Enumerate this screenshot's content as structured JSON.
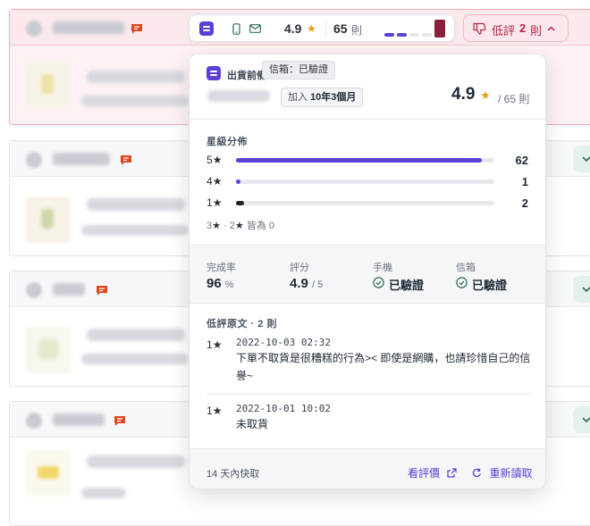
{
  "topbar": {
    "score": "4.9",
    "review_count": "65",
    "count_unit": "則",
    "colors": {
      "brand": "#5b3fd6",
      "star": "#e6a019",
      "low_bar": "#8a1f3c"
    }
  },
  "low_rating_button": {
    "label": "低評",
    "count": "2",
    "unit": "則"
  },
  "popover": {
    "brand_label": "出貨前備",
    "tooltip": "信箱：已驗證",
    "joined_prefix": "加入",
    "joined_value": "10年3個月",
    "score": "4.9",
    "total": "/ 65 則",
    "distribution": {
      "title": "星級分佈",
      "rows": [
        {
          "star": "5",
          "count": "62",
          "fraction": 0.95
        },
        {
          "star": "4",
          "count": "1",
          "fraction": 0.016
        },
        {
          "star": "1",
          "count": "2",
          "fraction": 0.032
        }
      ],
      "zero_note_stars": [
        "3",
        "2"
      ],
      "zero_note_text": "皆為 0"
    },
    "stats": {
      "completion_label": "完成率",
      "completion_value": "96",
      "completion_unit": "%",
      "rating_label": "評分",
      "rating_value": "4.9",
      "rating_unit": "/ 5",
      "phone_label": "手機",
      "phone_value": "已驗證",
      "email_label": "信箱",
      "email_value": "已驗證"
    },
    "low_reviews": {
      "title": "低評原文 · 2 則",
      "items": [
        {
          "star": "1",
          "time": "2022-10-03 02:32",
          "text": "下單不取貨是很糟糕的行為>< 即使是網購，也請珍惜自己的信譽~"
        },
        {
          "star": "1",
          "time": "2022-10-01 10:02",
          "text": "未取貨"
        }
      ]
    },
    "footer": {
      "note": "14 天內快取",
      "view_reviews": "看評價",
      "reload": "重新讀取"
    }
  }
}
